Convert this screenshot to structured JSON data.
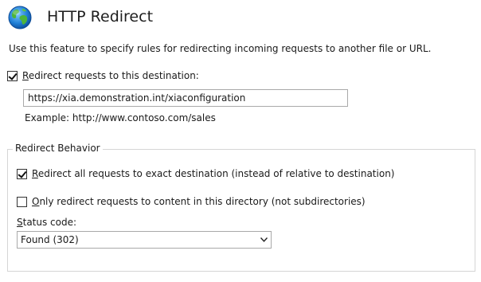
{
  "header": {
    "title": "HTTP Redirect",
    "icon": "globe-icon"
  },
  "description": "Use this feature to specify rules for redirecting incoming requests to another file or URL.",
  "redirect": {
    "checkbox_prefix": "",
    "checkbox_mnemonic": "R",
    "checkbox_rest": "edirect requests to this destination:",
    "checked": true,
    "destination_value": "https://xia.demonstration.int/xiaconfiguration",
    "example": "Example: http://www.contoso.com/sales"
  },
  "behavior": {
    "legend": "Redirect Behavior",
    "exact": {
      "mnemonic": "R",
      "rest": "edirect all requests to exact destination (instead of relative to destination)",
      "checked": true
    },
    "only_dir": {
      "mnemonic": "O",
      "rest": "nly redirect requests to content in this directory (not subdirectories)",
      "checked": false
    },
    "status": {
      "label_mnemonic": "S",
      "label_rest": "tatus code:",
      "selected": "Found (302)"
    }
  },
  "colors": {
    "globe_ocean": "#1f7fd6",
    "globe_land": "#4db53a",
    "border": "#a9a9a9",
    "group_border": "#d5d5d5"
  }
}
